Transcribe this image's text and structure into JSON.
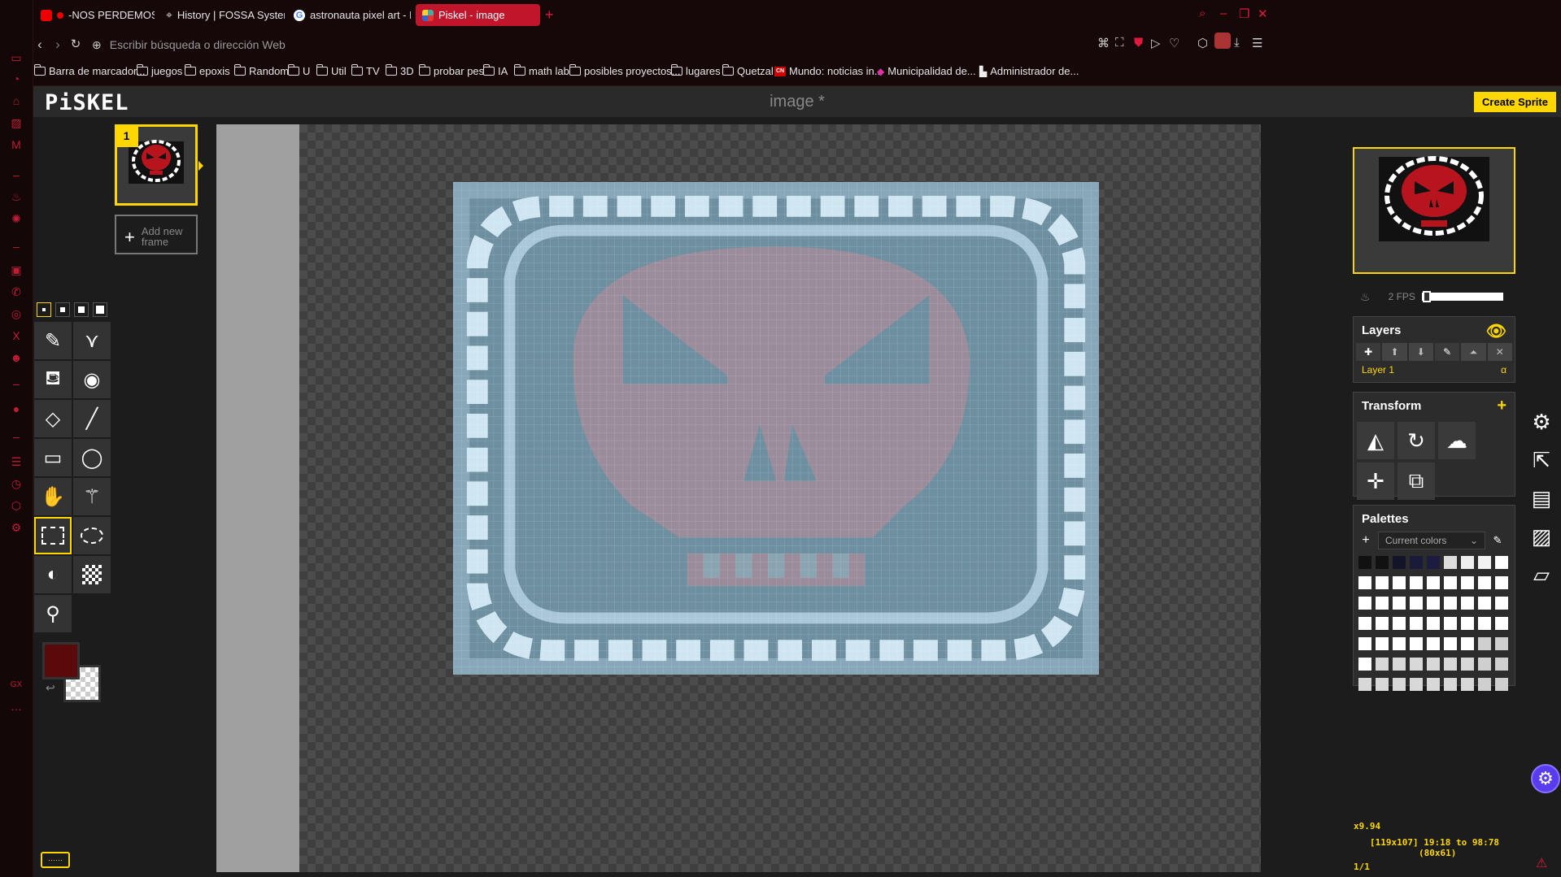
{
  "browser": {
    "tabs": [
      {
        "label": "-NOS PERDEMOS EN E",
        "icon": "youtube-icon",
        "active": false
      },
      {
        "label": "History | FOSSA Systems",
        "icon": "fossa-icon",
        "active": false
      },
      {
        "label": "astronauta pixel art - Bus",
        "icon": "google-icon",
        "active": false
      },
      {
        "label": "Piskel - image",
        "icon": "piskel-icon",
        "active": true
      }
    ],
    "new_tab": "+",
    "address_placeholder": "Escribir búsqueda o dirección Web",
    "bookmarks": [
      {
        "label": "Barra de marcador...",
        "icon": "folder"
      },
      {
        "label": "juegos",
        "icon": "folder"
      },
      {
        "label": "epoxis",
        "icon": "folder"
      },
      {
        "label": "Random",
        "icon": "folder"
      },
      {
        "label": "U",
        "icon": "folder"
      },
      {
        "label": "Util",
        "icon": "folder"
      },
      {
        "label": "TV",
        "icon": "folder"
      },
      {
        "label": "3D",
        "icon": "folder"
      },
      {
        "label": "probar pes",
        "icon": "folder"
      },
      {
        "label": "IA",
        "icon": "folder"
      },
      {
        "label": "math lab",
        "icon": "folder"
      },
      {
        "label": "posibles proyectos...",
        "icon": "folder"
      },
      {
        "label": "lugares",
        "icon": "folder"
      },
      {
        "label": "Quetzal",
        "icon": "folder"
      },
      {
        "label": "Mundo: noticias in...",
        "icon": "cnn-icon"
      },
      {
        "label": "Municipalidad de...",
        "icon": "gem-icon"
      },
      {
        "label": "Administrador de...",
        "icon": "doc-icon"
      }
    ],
    "accent": "#c0152b"
  },
  "piskel": {
    "logo": "PiSKEL",
    "title": "image *",
    "create_sprite": "Create Sprite",
    "frame_number": "1",
    "add_frame": "Add new frame",
    "fps": "2 FPS",
    "fps_level": 0.05,
    "layers_title": "Layers",
    "layer_name": "Layer 1",
    "layer_alpha": "α",
    "transform_title": "Transform",
    "palettes_title": "Palettes",
    "palette_select": "Current colors",
    "zoom": "x9.94",
    "cursor_info": "[119x107] 19:18 to 98:78",
    "selection_size": "(80x61)",
    "frame_counter": "1/1",
    "primary_color": "#5a0a0a",
    "highlight": "#ffd700"
  }
}
